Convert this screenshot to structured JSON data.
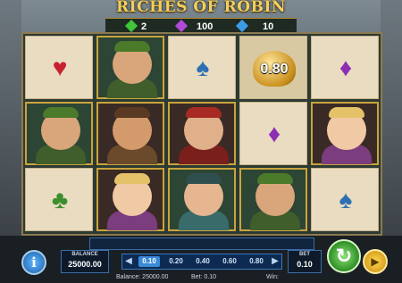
{
  "title": "RICHES OF ROBIN",
  "top_counters": [
    {
      "icon": "green-gem-icon",
      "color": "#3fc43a",
      "value": "2"
    },
    {
      "icon": "purple-gem-icon",
      "color": "#b04ad9",
      "value": "100"
    },
    {
      "icon": "blue-gem-icon",
      "color": "#3b9ce8",
      "value": "10"
    }
  ],
  "reels": [
    [
      {
        "type": "suit",
        "icon": "red-heart-icon",
        "glyph": "♥",
        "color": "#c7202e"
      },
      {
        "type": "char",
        "icon": "robin-hood-icon",
        "face": "#d9a57a",
        "hat": "#4b7a2a",
        "body": "#3f5e2c"
      },
      {
        "type": "suit",
        "icon": "green-club-icon",
        "glyph": "♣",
        "color": "#3c8f2c"
      }
    ],
    [
      {
        "type": "char",
        "icon": "robin-hood-icon",
        "face": "#d9a57a",
        "hat": "#4b7a2a",
        "body": "#3f5e2c"
      },
      {
        "type": "char",
        "icon": "friar-tuck-icon",
        "face": "#d39b6c",
        "hat": "#5a3a22",
        "body": "#6b4a2b",
        "bg": "dark"
      },
      {
        "type": "char",
        "icon": "maid-marian-icon",
        "face": "#f0c9a5",
        "hat": "#e4c26a",
        "body": "#7c3d7e",
        "bg": "dark"
      }
    ],
    [
      {
        "type": "suit",
        "icon": "blue-spade-icon",
        "glyph": "♠",
        "color": "#2e6fb3"
      },
      {
        "type": "char",
        "icon": "red-hood-woman-icon",
        "face": "#e0b08b",
        "hat": "#a72b23",
        "body": "#7a1f1c",
        "bg": "dark"
      },
      {
        "type": "char",
        "icon": "minstrel-icon",
        "face": "#e6b690",
        "hat": "#2f4f4f",
        "body": "#3a6b6b"
      }
    ],
    [
      {
        "type": "prize",
        "icon": "gold-coin-sack-icon",
        "value": "0.80"
      },
      {
        "type": "suit",
        "icon": "purple-diamond-icon",
        "glyph": "♦",
        "color": "#8c2fb5"
      },
      {
        "type": "char",
        "icon": "robin-hood-icon",
        "face": "#d9a57a",
        "hat": "#4b7a2a",
        "body": "#3f5e2c"
      }
    ],
    [
      {
        "type": "suit",
        "icon": "purple-diamond-icon",
        "glyph": "♦",
        "color": "#8c2fb5"
      },
      {
        "type": "char",
        "icon": "maid-marian-icon",
        "face": "#f0c9a5",
        "hat": "#e4c26a",
        "body": "#7c3d7e",
        "bg": "dark"
      },
      {
        "type": "suit",
        "icon": "blue-spade-icon",
        "glyph": "♠",
        "color": "#2e6fb3"
      }
    ]
  ],
  "controls": {
    "info_label": "i",
    "balance_label": "BALANCE",
    "balance_value": "25000.00",
    "bet_options": [
      "0.10",
      "0.20",
      "0.40",
      "0.60",
      "0.80"
    ],
    "selected_bet_index": 0,
    "bet_label": "BET",
    "bet_value": "0.10",
    "spin_icon": "↻",
    "autoplay_icon": "▶",
    "prev_arrow": "◀",
    "next_arrow": "▶"
  },
  "status": {
    "balance_text": "Balance: 25000.00",
    "bet_text": "Bet: 0.10",
    "win_text": "Win:"
  }
}
